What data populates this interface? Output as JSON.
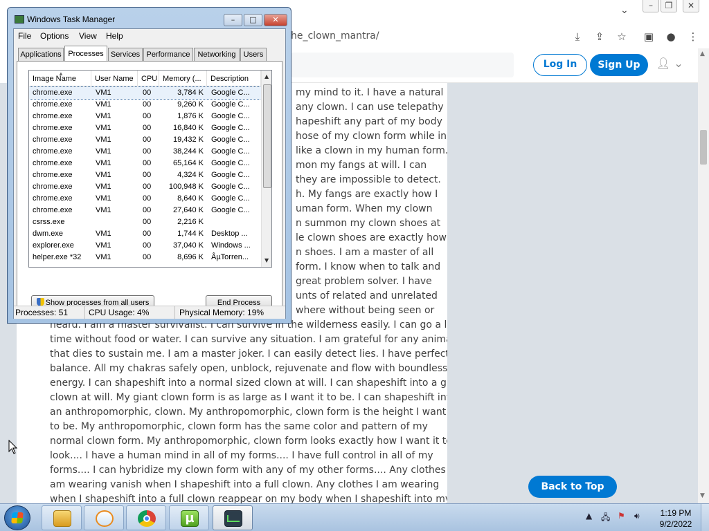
{
  "browser": {
    "url_visible": "he_clown_mantra/",
    "login_label": "Log In",
    "signup_label": "Sign Up",
    "back_to_top_label": "Back to Top",
    "post_lines": [
      "my mind to it. I have a natural",
      "any clown. I can use telepathy",
      "hapeshift any part of my body",
      "hose of my clown form while in",
      "like a clown in my human form.",
      "mon my fangs at will. I can",
      "they are impossible to detect.",
      "h. My fangs are exactly how I",
      "uman form. When my clown",
      "n summon my clown shoes at",
      "le clown shoes are exactly how I",
      "n shoes. I am a master of all",
      "form. I know when to talk and",
      "great problem solver. I have",
      "unts of related and unrelated",
      "where without being seen or",
      "heard. I am a master survivalist. I can survive in the wilderness easily. I can go a long",
      "time without food or water. I can survive any situation. I am grateful for any animal",
      "that dies to sustain me. I am a master joker. I can easily detect lies. I have perfect",
      "balance. All my chakras safely open, unblock, rejuvenate and flow with boundless",
      "energy. I can shapeshift into a normal sized clown at will. I can shapeshift into a giant",
      "clown at will. My giant clown form is as large as I want it to be. I can shapeshift into",
      "an anthropomorphic, clown. My anthropomorphic, clown form is the height I want it",
      "to be. My anthropomorphic, clown form has the same color and pattern of my",
      "normal clown form. My anthropomorphic, clown form looks exactly how I want it to",
      "look.... I have a human mind in all of my forms.... I have full control in all of my",
      "forms.... I can hybridize my clown form with any of my other forms.... Any clothes I",
      "am wearing vanish when I shapeshift into a full clown. Any clothes I am wearing",
      "when I shapeshift into a full clown reappear on my body when I shapeshift into my"
    ]
  },
  "taskmgr": {
    "title": "Windows Task Manager",
    "menu": [
      "File",
      "Options",
      "View",
      "Help"
    ],
    "tabs": [
      "Applications",
      "Processes",
      "Services",
      "Performance",
      "Networking",
      "Users"
    ],
    "active_tab": "Processes",
    "columns": [
      "Image Name",
      "User Name",
      "CPU",
      "Memory (...",
      "Description"
    ],
    "rows": [
      {
        "name": "chrome.exe",
        "user": "VM1",
        "cpu": "00",
        "mem": "3,784 K",
        "desc": "Google C..."
      },
      {
        "name": "chrome.exe",
        "user": "VM1",
        "cpu": "00",
        "mem": "9,260 K",
        "desc": "Google C..."
      },
      {
        "name": "chrome.exe",
        "user": "VM1",
        "cpu": "00",
        "mem": "1,876 K",
        "desc": "Google C..."
      },
      {
        "name": "chrome.exe",
        "user": "VM1",
        "cpu": "00",
        "mem": "16,840 K",
        "desc": "Google C..."
      },
      {
        "name": "chrome.exe",
        "user": "VM1",
        "cpu": "00",
        "mem": "19,432 K",
        "desc": "Google C..."
      },
      {
        "name": "chrome.exe",
        "user": "VM1",
        "cpu": "00",
        "mem": "38,244 K",
        "desc": "Google C..."
      },
      {
        "name": "chrome.exe",
        "user": "VM1",
        "cpu": "00",
        "mem": "65,164 K",
        "desc": "Google C..."
      },
      {
        "name": "chrome.exe",
        "user": "VM1",
        "cpu": "00",
        "mem": "4,324 K",
        "desc": "Google C..."
      },
      {
        "name": "chrome.exe",
        "user": "VM1",
        "cpu": "00",
        "mem": "100,948 K",
        "desc": "Google C..."
      },
      {
        "name": "chrome.exe",
        "user": "VM1",
        "cpu": "00",
        "mem": "8,640 K",
        "desc": "Google C..."
      },
      {
        "name": "chrome.exe",
        "user": "VM1",
        "cpu": "00",
        "mem": "27,640 K",
        "desc": "Google C..."
      },
      {
        "name": "csrss.exe",
        "user": "",
        "cpu": "00",
        "mem": "2,216 K",
        "desc": ""
      },
      {
        "name": "dwm.exe",
        "user": "VM1",
        "cpu": "00",
        "mem": "1,744 K",
        "desc": "Desktop ..."
      },
      {
        "name": "explorer.exe",
        "user": "VM1",
        "cpu": "00",
        "mem": "37,040 K",
        "desc": "Windows ..."
      },
      {
        "name": "helper.exe *32",
        "user": "VM1",
        "cpu": "00",
        "mem": "8,696 K",
        "desc": "ÂµTorren..."
      }
    ],
    "show_all_label": "Show processes from all users",
    "end_process_label": "End Process",
    "status_processes": "Processes: 51",
    "status_cpu": "CPU Usage: 4%",
    "status_memory": "Physical Memory: 19%"
  },
  "taskbar": {
    "time": "1:19 PM",
    "date": "9/2/2022"
  },
  "colors": {
    "accent": "#0079d3",
    "page_gray": "#dae0e6"
  }
}
